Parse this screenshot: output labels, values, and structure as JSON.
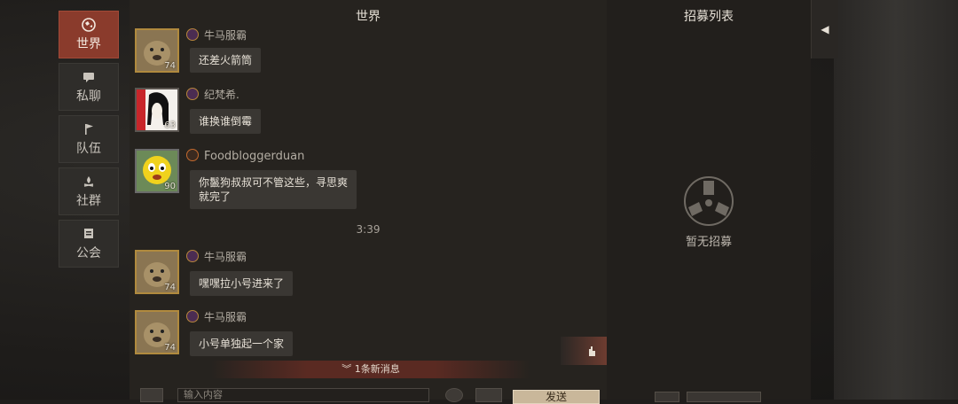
{
  "nav": {
    "world": "世界",
    "private": "私聊",
    "team": "队伍",
    "community": "社群",
    "guild": "公会"
  },
  "chat": {
    "title": "世界",
    "messages": [
      {
        "name": "牛马服霸",
        "level": "74",
        "text": "还差火箭筒"
      },
      {
        "name": "纪梵希.",
        "level": "63",
        "text": "谁换谁倒霉"
      },
      {
        "name": "Foodbloggerduan",
        "level": "90",
        "text": "你鬣狗叔叔可不管这些，寻思爽\n就完了"
      },
      {
        "name": "牛马服霸",
        "level": "74",
        "text": "嘿嘿拉小号进来了"
      },
      {
        "name": "牛马服霸",
        "level": "74",
        "text": "小号单独起一个家"
      }
    ],
    "timestamp": "3:39",
    "new_messages": "1条新消息",
    "input_placeholder": "输入内容",
    "send_label": "发送"
  },
  "recruit": {
    "title": "招募列表",
    "empty_text": "暂无招募"
  },
  "colors": {
    "nav_active": "#8a3b2c",
    "bubble": "#3a3733",
    "gold_frame": "#b08a3e"
  }
}
